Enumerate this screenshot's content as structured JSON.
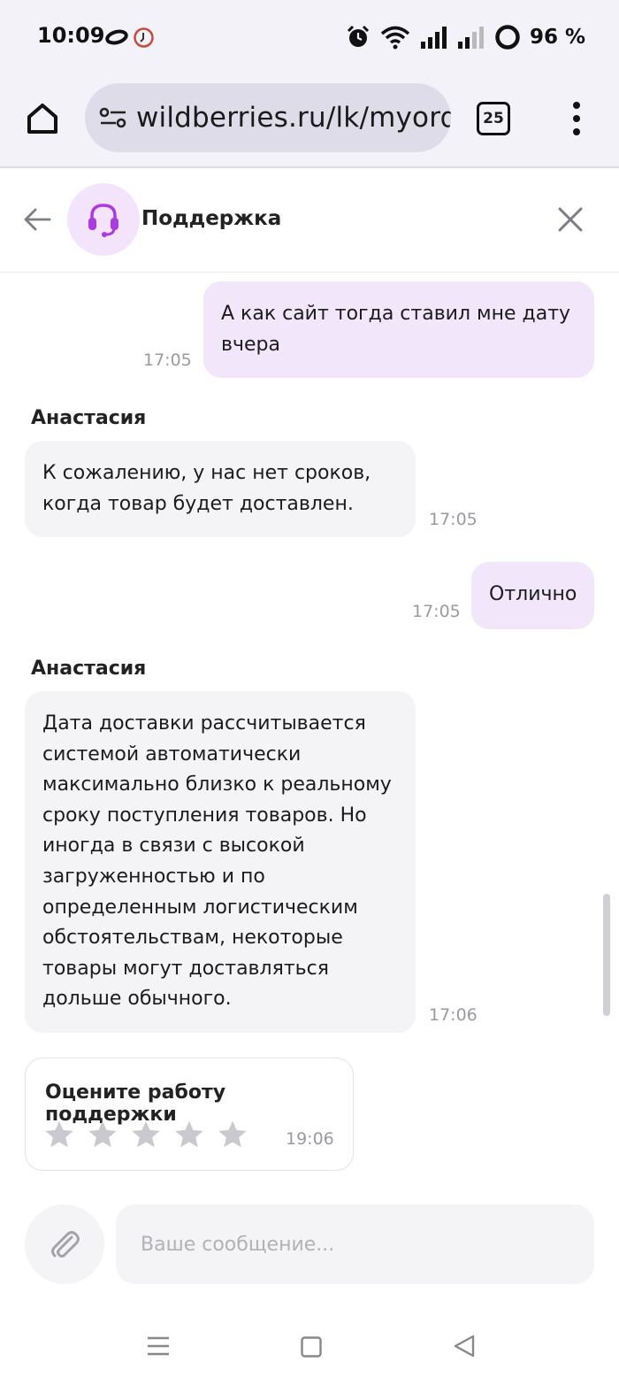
{
  "status_bar": {
    "time": "10:09",
    "battery": "96 %"
  },
  "browser": {
    "url": "wildberries.ru/lk/myorde",
    "tab_count": "25"
  },
  "chat": {
    "title": "Поддержка",
    "messages": [
      {
        "direction": "out",
        "text_lines": [
          "А как сайт тогда ставил мне дату",
          "вчера"
        ],
        "time": "17:05"
      },
      {
        "direction": "in",
        "sender": "Анастасия",
        "text_lines": [
          "К сожалению, у нас нет сроков,",
          "когда товар будет доставлен."
        ],
        "time": "17:05"
      },
      {
        "direction": "out",
        "text_lines": [
          "Отлично"
        ],
        "time": "17:05"
      },
      {
        "direction": "in",
        "sender": "Анастасия",
        "text_lines": [
          "Дата доставки рассчитывается",
          "системой автоматически",
          "максимально близко к реальному",
          "сроку поступления товаров. Но",
          "иногда в связи с высокой",
          "загруженностью и по",
          "определенным логистическим",
          "обстоятельствам, некоторые",
          "товары могут доставляться",
          "дольше обычного."
        ],
        "time": "17:06"
      }
    ],
    "rating": {
      "title": "Оцените работу поддержки",
      "time": "19:06",
      "stars_total": 5,
      "stars_selected": 0
    },
    "input_placeholder": "Ваше сообщение..."
  },
  "colors": {
    "accent": "#a93be0",
    "outgoing_bubble": "#f2e6fb",
    "incoming_bubble": "#f4f4f6",
    "star_inactive": "#c9c9cf"
  }
}
